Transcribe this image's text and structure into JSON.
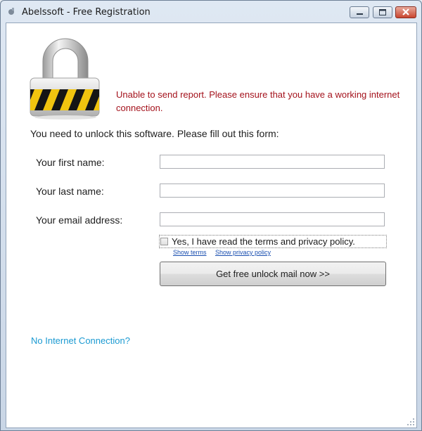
{
  "window": {
    "title": "Abelssoft - Free Registration",
    "icons": {
      "app": "abelssoft-app-icon",
      "minimize": "minimize-icon",
      "maximize": "maximize-icon",
      "close": "close-icon"
    }
  },
  "header": {
    "lock_icon": "padlock-icon",
    "error_message": "Unable to send report. Please ensure that you have a working internet connection."
  },
  "form": {
    "intro": "You need to unlock this software. Please fill out this form:",
    "first_name_label": "Your first name:",
    "first_name_value": "",
    "last_name_label": "Your last name:",
    "last_name_value": "",
    "email_label": "Your email address:",
    "email_value": "",
    "terms_label": "Yes, I have read the terms and privacy policy.",
    "terms_checked": false,
    "show_terms": "Show terms",
    "show_privacy": "Show privacy policy",
    "submit_label": "Get free unlock mail now >>"
  },
  "footer": {
    "no_internet_link": "No Internet Connection?"
  },
  "colors": {
    "error": "#a4121c",
    "link": "#1b9ad2",
    "sublink": "#1a4fb0"
  }
}
